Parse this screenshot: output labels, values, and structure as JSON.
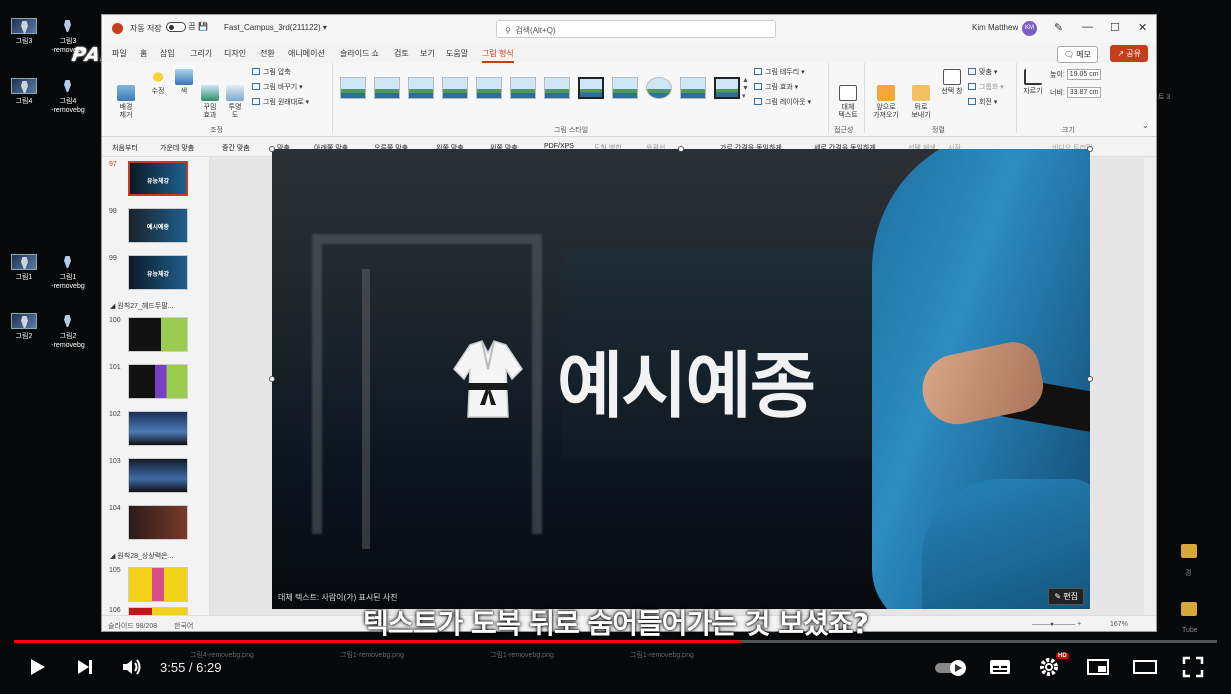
{
  "desktop": {
    "icons": [
      {
        "label": "그림3"
      },
      {
        "label": "그림3\n-removebg"
      },
      {
        "label": "그림4"
      },
      {
        "label": "그림4\n-removebg"
      },
      {
        "label": "그림1"
      },
      {
        "label": "그림1\n-removebg"
      },
      {
        "label": "그림2"
      },
      {
        "label": "그림2\n-removebg"
      }
    ],
    "logo": "PAPERLOGY",
    "right_labels": {
      "a": "트 3",
      "b": "경",
      "c": "Tube"
    }
  },
  "ppt": {
    "autosave_label": "자동 저장",
    "autosave_state": "끔",
    "filename": "Fast_Campus_3rd(211122)",
    "search_placeholder": "검색(Alt+Q)",
    "user_name": "Kim Matthew",
    "user_initials": "KM",
    "tabs": [
      "파일",
      "홈",
      "삽입",
      "그리기",
      "디자인",
      "전환",
      "애니메이션",
      "슬라이드 쇼",
      "검토",
      "보기",
      "도움말",
      "그림 형식"
    ],
    "memo_label": "메모",
    "share_label": "공유",
    "ribbon": {
      "adjust": {
        "remove_bg": "배경\n제거",
        "corrections": "수정",
        "color": "색",
        "artistic": "꾸밈\n효과",
        "transparency": "투명\n도",
        "compress": "그림 압축",
        "change": "그림 바꾸기",
        "reset": "그림 원래대로",
        "group_label": "조정"
      },
      "styles_group_label": "그림 스타일",
      "style_options": [
        "그림 테두리",
        "그림 효과",
        "그림 레이아웃"
      ],
      "accessibility": {
        "alt_text": "대체\n텍스트",
        "group_label": "접근성"
      },
      "arrange": {
        "bring_forward": "앞으로\n가져오기",
        "send_backward": "뒤로\n보내기",
        "selection_pane": "선택 창",
        "align": "맞춤",
        "group": "그룹화",
        "rotate": "회전",
        "group_label": "정렬"
      },
      "size": {
        "crop": "자르기",
        "height_label": "높이:",
        "height_value": "19.05 cm",
        "width_label": "너비:",
        "width_value": "33.87 cm",
        "group_label": "크기"
      }
    },
    "qat": [
      "처음부터",
      "가운데 맞춤",
      "중간 맞춤",
      "맞춤",
      "아래쪽 맞춤",
      "오른쪽 맞춤",
      "왼쪽 맞춤",
      "위쪽 맞춤",
      "PDF/XPS",
      "도형 병합",
      "윤곽선",
      "가로 간격을 동일하게",
      "세로 간격을 동일하게",
      "선택 재생",
      "시작",
      "비디오 트리밍"
    ],
    "thumbnails": [
      {
        "num": "97",
        "label": "유능체강",
        "selected": true
      },
      {
        "num": "98",
        "label": "예시예종"
      },
      {
        "num": "99",
        "label": "유능체강"
      },
      {
        "section": "원칙27_헤드두팔..."
      },
      {
        "num": "100",
        "label": ""
      },
      {
        "num": "101",
        "label": ""
      },
      {
        "num": "102",
        "label": ""
      },
      {
        "num": "103",
        "label": ""
      },
      {
        "num": "104",
        "label": ""
      },
      {
        "section": "원칙28_상상력은..."
      },
      {
        "num": "105",
        "label": ""
      },
      {
        "num": "106",
        "label": ""
      }
    ],
    "slide": {
      "main_text": "예시예종",
      "alt_text": "대체 텍스트: 사람이(가) 표시된 사진",
      "edit_label": "편집"
    },
    "status": {
      "slide_count": "슬라이드 98/208",
      "language": "한국어",
      "zoom": "167%"
    }
  },
  "subtitle": "텍스트가 도복 뒤로 숨어들어가는 것 보셨죠?",
  "taskbar_hint": [
    "그림4-removebg.png",
    "그림1-removebg.png",
    "그림1-removebg.png",
    "그림1-removebg.png"
  ],
  "player": {
    "current_time": "3:55",
    "duration": "6:29",
    "time_display": "3:55 / 6:29",
    "progress_fraction": 0.604,
    "hd_badge": "HD"
  }
}
